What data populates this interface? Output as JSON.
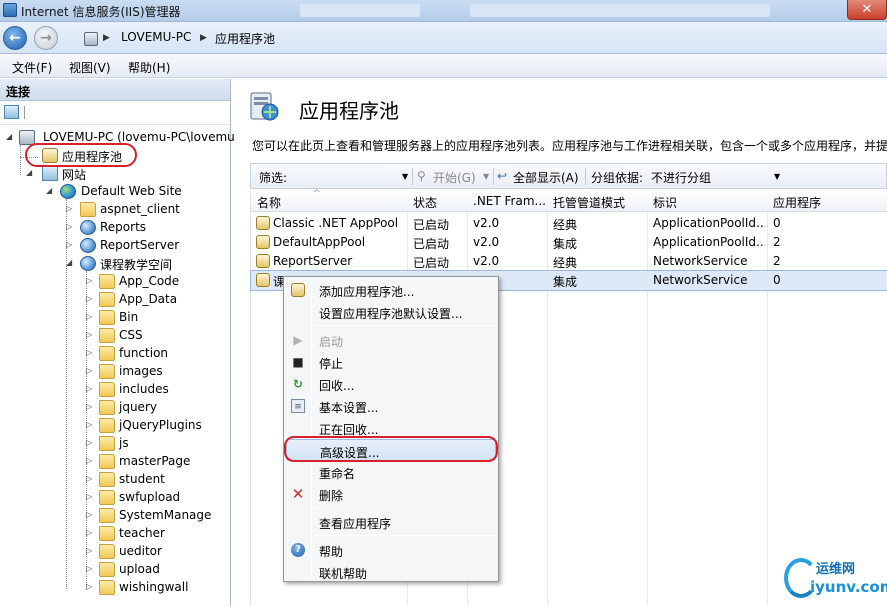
{
  "window": {
    "title": "Internet 信息服务(IIS)管理器",
    "close_label": "✕"
  },
  "address": {
    "crumbs": [
      "LOVEMU-PC",
      "应用程序池"
    ],
    "separator": "▶"
  },
  "menu": [
    "文件(F)",
    "视图(V)",
    "帮助(H)"
  ],
  "connections": {
    "header": "连接",
    "tree": [
      {
        "label": "LOVEMU-PC (lovemu-PC\\lovemu)",
        "icon": "server-icon"
      },
      {
        "label": "应用程序池",
        "icon": "app-pool-icon"
      },
      {
        "label": "网站",
        "icon": "sites-icon"
      },
      {
        "label": "Default Web Site",
        "icon": "globe-icon"
      },
      {
        "label": "aspnet_client",
        "icon": "folder-icon"
      },
      {
        "label": "Reports",
        "icon": "virtual-dir-icon"
      },
      {
        "label": "ReportServer",
        "icon": "virtual-dir-icon"
      },
      {
        "label": "课程教学空间",
        "icon": "virtual-dir-icon"
      },
      {
        "label": "App_Code",
        "icon": "folder-icon"
      },
      {
        "label": "App_Data",
        "icon": "folder-icon"
      },
      {
        "label": "Bin",
        "icon": "folder-icon"
      },
      {
        "label": "CSS",
        "icon": "folder-icon"
      },
      {
        "label": "function",
        "icon": "folder-icon"
      },
      {
        "label": "images",
        "icon": "folder-icon"
      },
      {
        "label": "includes",
        "icon": "folder-icon"
      },
      {
        "label": "jquery",
        "icon": "folder-icon"
      },
      {
        "label": "jQueryPlugins",
        "icon": "folder-icon"
      },
      {
        "label": "js",
        "icon": "folder-icon"
      },
      {
        "label": "masterPage",
        "icon": "folder-icon"
      },
      {
        "label": "student",
        "icon": "folder-icon"
      },
      {
        "label": "swfupload",
        "icon": "folder-icon"
      },
      {
        "label": "SystemManage",
        "icon": "folder-icon"
      },
      {
        "label": "teacher",
        "icon": "folder-icon"
      },
      {
        "label": "ueditor",
        "icon": "folder-icon"
      },
      {
        "label": "upload",
        "icon": "folder-icon"
      },
      {
        "label": "wishingwall",
        "icon": "folder-icon"
      }
    ]
  },
  "main": {
    "title": "应用程序池",
    "description": "您可以在此页上查看和管理服务器上的应用程序池列表。应用程序池与工作进程相关联，包含一个或多个应用程序，并提",
    "filter": {
      "label": "筛选:",
      "start_label": "开始(G)",
      "show_all_label": "全部显示(A)",
      "group_label": "分组依据:",
      "group_value": "不进行分组"
    },
    "columns": [
      "名称",
      "状态",
      ".NET Fram...",
      "托管管道模式",
      "标识",
      "应用程序"
    ],
    "rows": [
      [
        "Classic .NET AppPool",
        "已启动",
        "v2.0",
        "经典",
        "ApplicationPoolId...",
        "0"
      ],
      [
        "DefaultAppPool",
        "已启动",
        "v2.0",
        "集成",
        "ApplicationPoolId...",
        "2"
      ],
      [
        "ReportServer",
        "已启动",
        "v2.0",
        "经典",
        "NetworkService",
        "2"
      ],
      [
        "课",
        "",
        "",
        "集成",
        "NetworkService",
        "0"
      ]
    ]
  },
  "context_menu": {
    "items": [
      {
        "label": "添加应用程序池...",
        "icon": "add-pool-icon"
      },
      {
        "label": "设置应用程序池默认设置...",
        "icon": ""
      },
      {
        "label": "启动",
        "icon": "play-icon"
      },
      {
        "label": "停止",
        "icon": "stop-icon"
      },
      {
        "label": "回收...",
        "icon": "recycle-icon"
      },
      {
        "label": "基本设置...",
        "icon": "basic-settings-icon"
      },
      {
        "label": "正在回收...",
        "icon": ""
      },
      {
        "label": "高级设置...",
        "icon": ""
      },
      {
        "label": "重命名",
        "icon": ""
      },
      {
        "label": "删除",
        "icon": "delete-icon"
      },
      {
        "label": "查看应用程序",
        "icon": ""
      },
      {
        "label": "帮助",
        "icon": "help-icon"
      },
      {
        "label": "联机帮助",
        "icon": ""
      }
    ]
  },
  "watermark": {
    "line1": "运维网",
    "line2": "iyunv.com"
  },
  "colors": {
    "highlight": "#d7202a",
    "selection": "#dde9f7"
  }
}
